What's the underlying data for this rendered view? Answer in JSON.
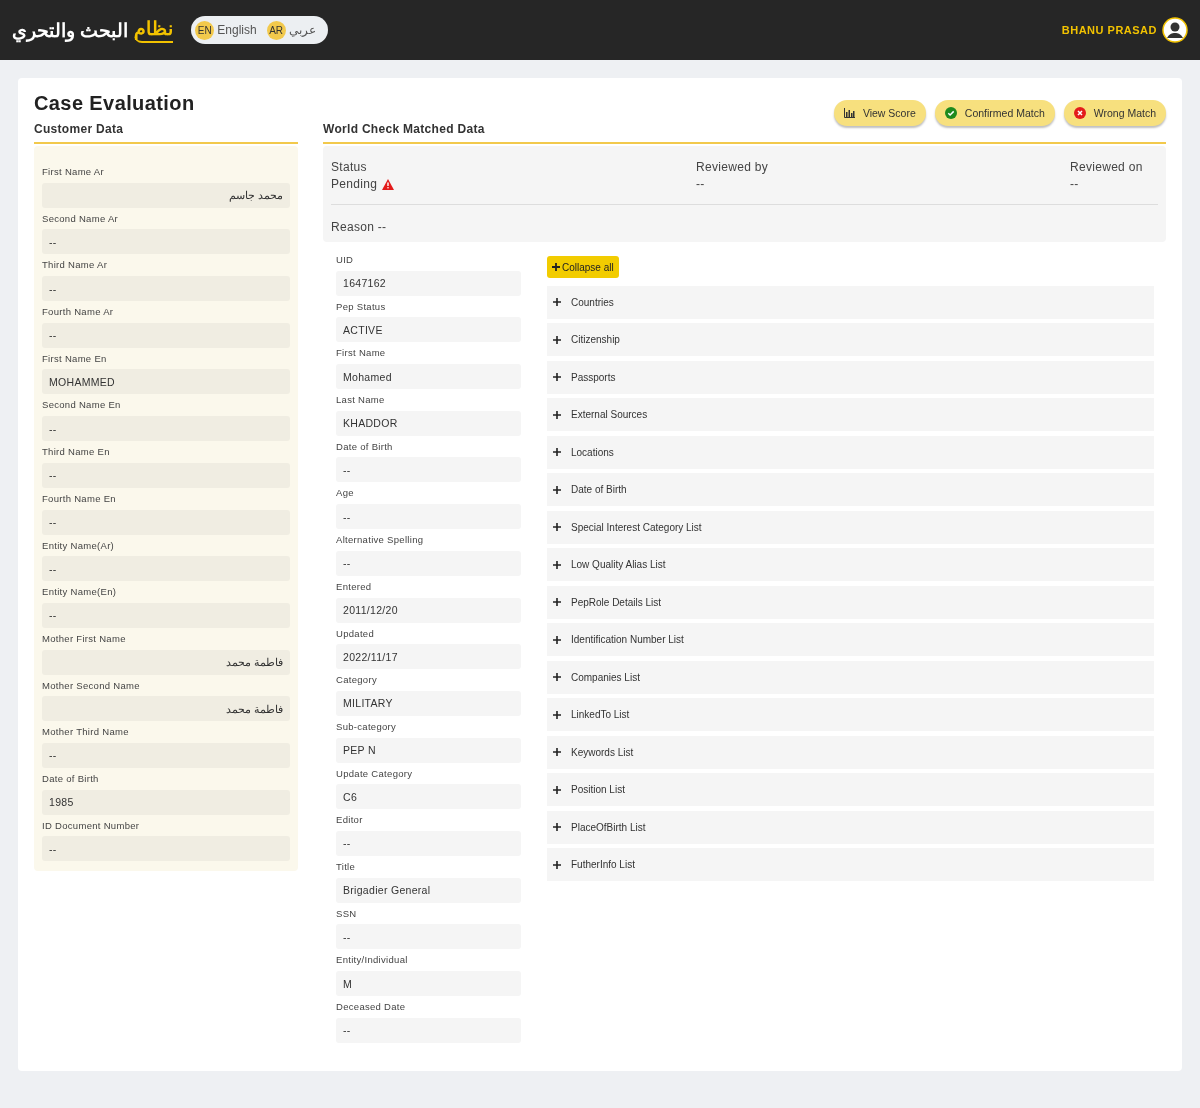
{
  "header": {
    "logo": {
      "accent": "نظام",
      "text": "البحث والتحري"
    },
    "languages": [
      {
        "code": "EN",
        "label": "English"
      },
      {
        "code": "AR",
        "label": "عربي"
      }
    ],
    "user": "BHANU PRASAD"
  },
  "page": {
    "title": "Case Evaluation",
    "actions": [
      {
        "kind": "score",
        "label": "View Score"
      },
      {
        "kind": "confirm",
        "label": "Confirmed Match"
      },
      {
        "kind": "wrong",
        "label": "Wrong Match"
      }
    ]
  },
  "customer": {
    "heading": "Customer Data",
    "fields": [
      {
        "label": "First Name Ar",
        "value": "محمد جاسم"
      },
      {
        "label": "Second Name Ar",
        "value": "--"
      },
      {
        "label": "Third Name Ar",
        "value": "--"
      },
      {
        "label": "Fourth Name Ar",
        "value": "--"
      },
      {
        "label": "First Name En",
        "value": "MOHAMMED"
      },
      {
        "label": "Second Name En",
        "value": "--"
      },
      {
        "label": "Third Name En",
        "value": "--"
      },
      {
        "label": "Fourth Name En",
        "value": "--"
      },
      {
        "label": "Entity Name(Ar)",
        "value": "--"
      },
      {
        "label": "Entity Name(En)",
        "value": "--"
      },
      {
        "label": "Mother First Name",
        "value": "فاطمة محمد"
      },
      {
        "label": "Mother Second Name",
        "value": "فاطمة محمد"
      },
      {
        "label": "Mother Third Name",
        "value": "--"
      },
      {
        "label": "Date of Birth",
        "value": "1985"
      },
      {
        "label": "ID Document Number",
        "value": "--"
      }
    ]
  },
  "world_check": {
    "heading": "World Check Matched Data",
    "summary": {
      "status_label": "Status",
      "status": "Pending",
      "status_warning": true,
      "reviewed_by_label": "Reviewed by",
      "reviewed_by": "--",
      "reviewed_on_label": "Reviewed on",
      "reviewed_on": "--",
      "reason": "Reason --"
    },
    "fields": [
      {
        "label": "UID",
        "value": "1647162"
      },
      {
        "label": "Pep Status",
        "value": "ACTIVE"
      },
      {
        "label": "First Name",
        "value": "Mohamed"
      },
      {
        "label": "Last Name",
        "value": "KHADDOR"
      },
      {
        "label": "Date of Birth",
        "value": "--"
      },
      {
        "label": "Age",
        "value": "--"
      },
      {
        "label": "Alternative Spelling",
        "value": "--"
      },
      {
        "label": "Entered",
        "value": "2011/12/20"
      },
      {
        "label": "Updated",
        "value": "2022/11/17"
      },
      {
        "label": "Category",
        "value": "MILITARY"
      },
      {
        "label": "Sub-category",
        "value": "PEP N"
      },
      {
        "label": "Update Category",
        "value": "C6"
      },
      {
        "label": "Editor",
        "value": "--"
      },
      {
        "label": "Title",
        "value": "Brigadier General"
      },
      {
        "label": "SSN",
        "value": "--"
      },
      {
        "label": "Entity/Individual",
        "value": "M"
      },
      {
        "label": "Deceased Date",
        "value": "--"
      }
    ],
    "collapse_button": "Collapse all",
    "sections": [
      {
        "label": "Countries",
        "expanded": false
      },
      {
        "label": "Citizenship",
        "expanded": false
      },
      {
        "label": "Passports",
        "expanded": false
      },
      {
        "label": "External Sources",
        "expanded": false
      },
      {
        "label": "Locations",
        "expanded": false
      },
      {
        "label": "Date of Birth",
        "expanded": false
      },
      {
        "label": "Special Interest Category List",
        "expanded": false
      },
      {
        "label": "Low Quality Alias List",
        "expanded": false
      },
      {
        "label": "PepRole Details List",
        "expanded": false
      },
      {
        "label": "Identification Number List",
        "expanded": false
      },
      {
        "label": "Companies List",
        "expanded": false
      },
      {
        "label": "LinkedTo List",
        "expanded": false
      },
      {
        "label": "Keywords List",
        "expanded": false
      },
      {
        "label": "Position List",
        "expanded": false
      },
      {
        "label": "PlaceOfBirth List",
        "expanded": false
      },
      {
        "label": "FutherInfo List",
        "expanded": false
      }
    ]
  }
}
